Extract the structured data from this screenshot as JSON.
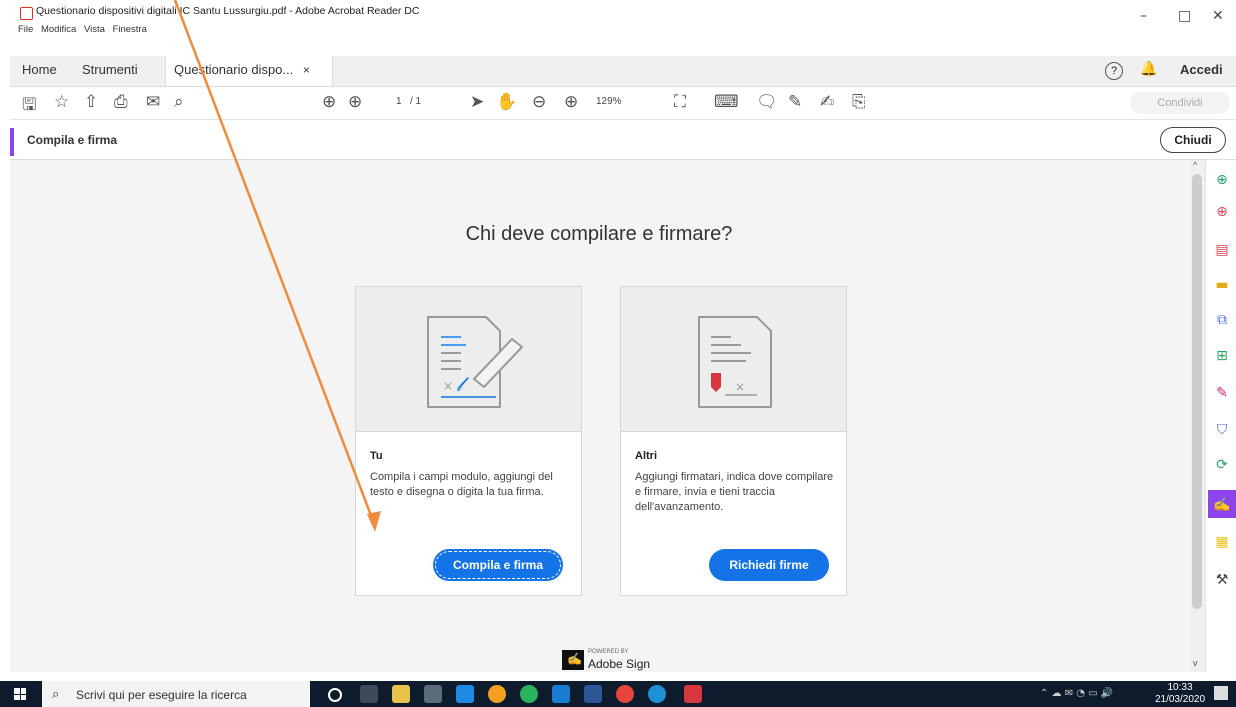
{
  "window": {
    "title": "Questionario dispositivi digitali IC Santu Lussurgiu.pdf - Adobe Acrobat Reader DC",
    "menu": [
      "File",
      "Modifica",
      "Vista",
      "Finestra"
    ]
  },
  "tabs": {
    "home": "Home",
    "tools": "Strumenti",
    "document": "Questionario dispo...",
    "close": "×",
    "sign_in": "Accedi"
  },
  "toolbar": {
    "page_current": "1",
    "page_total": "/ 1",
    "zoom": "129%",
    "share": "Condividi"
  },
  "tool_header": {
    "title": "Compila e firma",
    "close_button": "Chiudi"
  },
  "main": {
    "question": "Chi deve compilare e firmare?",
    "cards": [
      {
        "title": "Tu",
        "description": "Compila i campi modulo, aggiungi del testo e disegna o digita la tua firma.",
        "button": "Compila e firma"
      },
      {
        "title": "Altri",
        "description": "Aggiungi firmatari, indica dove compilare e firmare, invia e tieni traccia dell'avanzamento.",
        "button": "Richiedi firme"
      }
    ],
    "footer_small": "POWERED BY",
    "footer_brand": "Adobe Sign"
  },
  "taskbar": {
    "search_placeholder": "Scrivi qui per eseguire la ricerca",
    "time": "10:33",
    "date": "21/03/2020"
  },
  "colors": {
    "accent": "#8e44ec",
    "button": "#1473e6",
    "arrow": "#f08a3c",
    "taskbar": "#0e1b2c"
  }
}
